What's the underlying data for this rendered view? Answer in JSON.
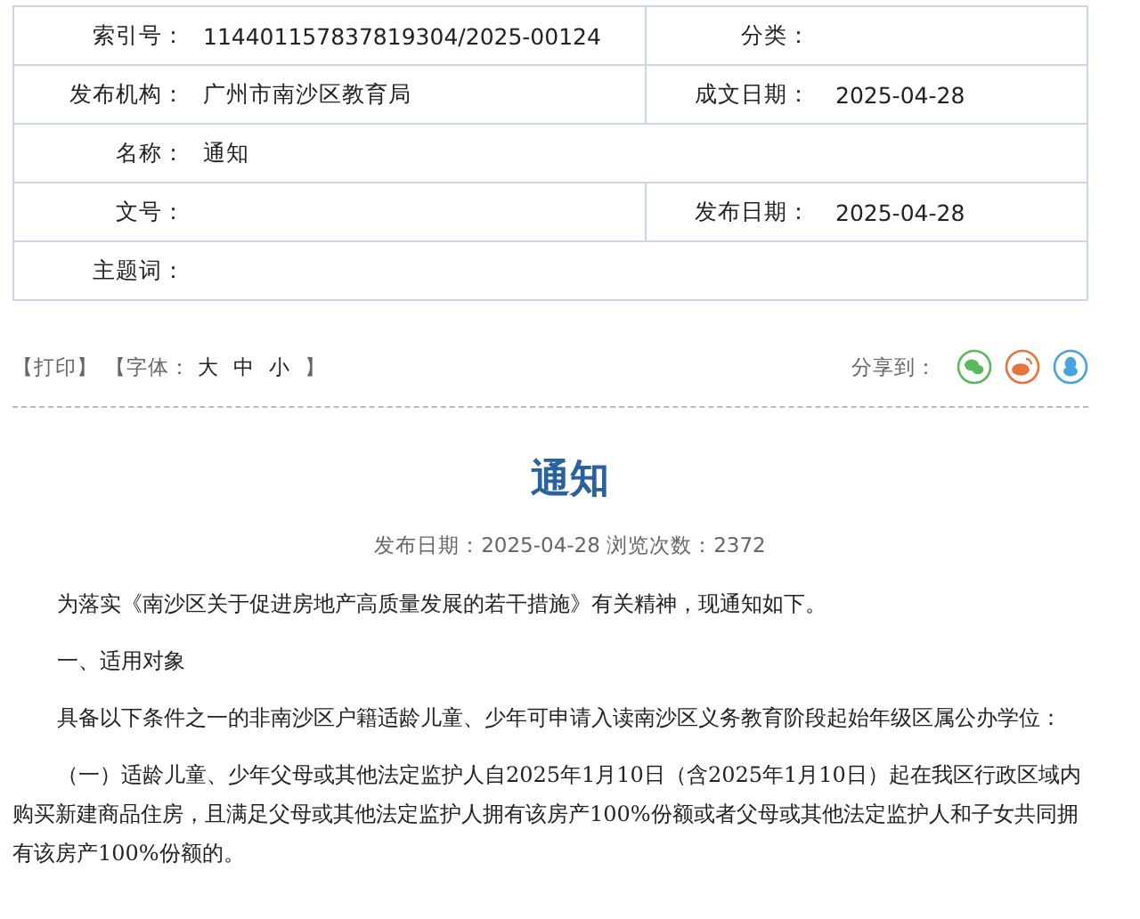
{
  "info_table": [
    {
      "cells": [
        {
          "label": "索引号：",
          "value": "114401157837819304/2025-00124"
        },
        {
          "label": "分类："
        }
      ]
    },
    {
      "cells": [
        {
          "label": "发布机构：",
          "value": "广州市南沙区教育局"
        },
        {
          "label": "成文日期：",
          "value": "2025-04-28"
        }
      ]
    },
    {
      "cells": [
        {
          "label": "名称：",
          "value": "通知"
        }
      ]
    },
    {
      "cells": [
        {
          "label": "文号："
        },
        {
          "label": "发布日期：",
          "value": "2025-04-28"
        }
      ]
    },
    {
      "cells": [
        {
          "label": "主题词："
        }
      ]
    }
  ],
  "toolbar": {
    "print": "【打印】",
    "font_label": "【字体：",
    "font_sizes": [
      "大",
      "中",
      "小"
    ],
    "font_close": "】",
    "share_label": "分享到：",
    "share": [
      {
        "kind": "wechat",
        "color": "#5cb85c"
      },
      {
        "kind": "weibo",
        "color": "#e8743b"
      },
      {
        "kind": "qq",
        "color": "#4aa3df"
      }
    ]
  },
  "article": {
    "title": "通知",
    "meta": "发布日期：2025-04-28  浏览次数：2372",
    "paragraphs": [
      "为落实《南沙区关于促进房地产高质量发展的若干措施》有关精神，现通知如下。",
      "一、适用对象",
      "具备以下条件之一的非南沙区户籍适龄儿童、少年可申请入读南沙区义务教育阶段起始年级区属公办学位：",
      "（一）适龄儿童、少年父母或其他法定监护人自2025年1月10日（含2025年1月10日）起在我区行政区域内购买新建商品住房，且满足父母或其他法定监护人拥有该房产100%份额或者父母或其他法定监护人和子女共同拥有该房产100%份额的。"
    ]
  }
}
